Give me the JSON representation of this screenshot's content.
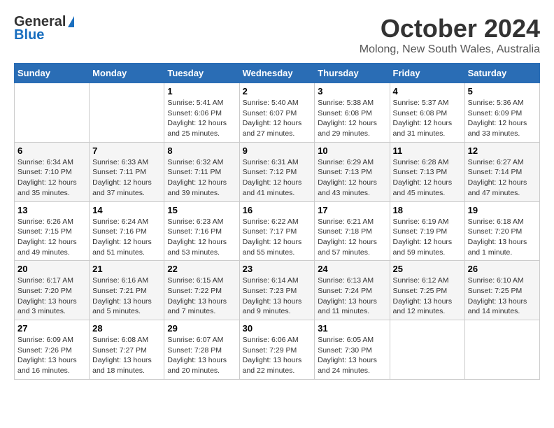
{
  "logo": {
    "general": "General",
    "blue": "Blue"
  },
  "header": {
    "month": "October 2024",
    "location": "Molong, New South Wales, Australia"
  },
  "weekdays": [
    "Sunday",
    "Monday",
    "Tuesday",
    "Wednesday",
    "Thursday",
    "Friday",
    "Saturday"
  ],
  "weeks": [
    [
      {
        "day": "",
        "sunrise": "",
        "sunset": "",
        "daylight": ""
      },
      {
        "day": "",
        "sunrise": "",
        "sunset": "",
        "daylight": ""
      },
      {
        "day": "1",
        "sunrise": "Sunrise: 5:41 AM",
        "sunset": "Sunset: 6:06 PM",
        "daylight": "Daylight: 12 hours and 25 minutes."
      },
      {
        "day": "2",
        "sunrise": "Sunrise: 5:40 AM",
        "sunset": "Sunset: 6:07 PM",
        "daylight": "Daylight: 12 hours and 27 minutes."
      },
      {
        "day": "3",
        "sunrise": "Sunrise: 5:38 AM",
        "sunset": "Sunset: 6:08 PM",
        "daylight": "Daylight: 12 hours and 29 minutes."
      },
      {
        "day": "4",
        "sunrise": "Sunrise: 5:37 AM",
        "sunset": "Sunset: 6:08 PM",
        "daylight": "Daylight: 12 hours and 31 minutes."
      },
      {
        "day": "5",
        "sunrise": "Sunrise: 5:36 AM",
        "sunset": "Sunset: 6:09 PM",
        "daylight": "Daylight: 12 hours and 33 minutes."
      }
    ],
    [
      {
        "day": "6",
        "sunrise": "Sunrise: 6:34 AM",
        "sunset": "Sunset: 7:10 PM",
        "daylight": "Daylight: 12 hours and 35 minutes."
      },
      {
        "day": "7",
        "sunrise": "Sunrise: 6:33 AM",
        "sunset": "Sunset: 7:11 PM",
        "daylight": "Daylight: 12 hours and 37 minutes."
      },
      {
        "day": "8",
        "sunrise": "Sunrise: 6:32 AM",
        "sunset": "Sunset: 7:11 PM",
        "daylight": "Daylight: 12 hours and 39 minutes."
      },
      {
        "day": "9",
        "sunrise": "Sunrise: 6:31 AM",
        "sunset": "Sunset: 7:12 PM",
        "daylight": "Daylight: 12 hours and 41 minutes."
      },
      {
        "day": "10",
        "sunrise": "Sunrise: 6:29 AM",
        "sunset": "Sunset: 7:13 PM",
        "daylight": "Daylight: 12 hours and 43 minutes."
      },
      {
        "day": "11",
        "sunrise": "Sunrise: 6:28 AM",
        "sunset": "Sunset: 7:13 PM",
        "daylight": "Daylight: 12 hours and 45 minutes."
      },
      {
        "day": "12",
        "sunrise": "Sunrise: 6:27 AM",
        "sunset": "Sunset: 7:14 PM",
        "daylight": "Daylight: 12 hours and 47 minutes."
      }
    ],
    [
      {
        "day": "13",
        "sunrise": "Sunrise: 6:26 AM",
        "sunset": "Sunset: 7:15 PM",
        "daylight": "Daylight: 12 hours and 49 minutes."
      },
      {
        "day": "14",
        "sunrise": "Sunrise: 6:24 AM",
        "sunset": "Sunset: 7:16 PM",
        "daylight": "Daylight: 12 hours and 51 minutes."
      },
      {
        "day": "15",
        "sunrise": "Sunrise: 6:23 AM",
        "sunset": "Sunset: 7:16 PM",
        "daylight": "Daylight: 12 hours and 53 minutes."
      },
      {
        "day": "16",
        "sunrise": "Sunrise: 6:22 AM",
        "sunset": "Sunset: 7:17 PM",
        "daylight": "Daylight: 12 hours and 55 minutes."
      },
      {
        "day": "17",
        "sunrise": "Sunrise: 6:21 AM",
        "sunset": "Sunset: 7:18 PM",
        "daylight": "Daylight: 12 hours and 57 minutes."
      },
      {
        "day": "18",
        "sunrise": "Sunrise: 6:19 AM",
        "sunset": "Sunset: 7:19 PM",
        "daylight": "Daylight: 12 hours and 59 minutes."
      },
      {
        "day": "19",
        "sunrise": "Sunrise: 6:18 AM",
        "sunset": "Sunset: 7:20 PM",
        "daylight": "Daylight: 13 hours and 1 minute."
      }
    ],
    [
      {
        "day": "20",
        "sunrise": "Sunrise: 6:17 AM",
        "sunset": "Sunset: 7:20 PM",
        "daylight": "Daylight: 13 hours and 3 minutes."
      },
      {
        "day": "21",
        "sunrise": "Sunrise: 6:16 AM",
        "sunset": "Sunset: 7:21 PM",
        "daylight": "Daylight: 13 hours and 5 minutes."
      },
      {
        "day": "22",
        "sunrise": "Sunrise: 6:15 AM",
        "sunset": "Sunset: 7:22 PM",
        "daylight": "Daylight: 13 hours and 7 minutes."
      },
      {
        "day": "23",
        "sunrise": "Sunrise: 6:14 AM",
        "sunset": "Sunset: 7:23 PM",
        "daylight": "Daylight: 13 hours and 9 minutes."
      },
      {
        "day": "24",
        "sunrise": "Sunrise: 6:13 AM",
        "sunset": "Sunset: 7:24 PM",
        "daylight": "Daylight: 13 hours and 11 minutes."
      },
      {
        "day": "25",
        "sunrise": "Sunrise: 6:12 AM",
        "sunset": "Sunset: 7:25 PM",
        "daylight": "Daylight: 13 hours and 12 minutes."
      },
      {
        "day": "26",
        "sunrise": "Sunrise: 6:10 AM",
        "sunset": "Sunset: 7:25 PM",
        "daylight": "Daylight: 13 hours and 14 minutes."
      }
    ],
    [
      {
        "day": "27",
        "sunrise": "Sunrise: 6:09 AM",
        "sunset": "Sunset: 7:26 PM",
        "daylight": "Daylight: 13 hours and 16 minutes."
      },
      {
        "day": "28",
        "sunrise": "Sunrise: 6:08 AM",
        "sunset": "Sunset: 7:27 PM",
        "daylight": "Daylight: 13 hours and 18 minutes."
      },
      {
        "day": "29",
        "sunrise": "Sunrise: 6:07 AM",
        "sunset": "Sunset: 7:28 PM",
        "daylight": "Daylight: 13 hours and 20 minutes."
      },
      {
        "day": "30",
        "sunrise": "Sunrise: 6:06 AM",
        "sunset": "Sunset: 7:29 PM",
        "daylight": "Daylight: 13 hours and 22 minutes."
      },
      {
        "day": "31",
        "sunrise": "Sunrise: 6:05 AM",
        "sunset": "Sunset: 7:30 PM",
        "daylight": "Daylight: 13 hours and 24 minutes."
      },
      {
        "day": "",
        "sunrise": "",
        "sunset": "",
        "daylight": ""
      },
      {
        "day": "",
        "sunrise": "",
        "sunset": "",
        "daylight": ""
      }
    ]
  ]
}
